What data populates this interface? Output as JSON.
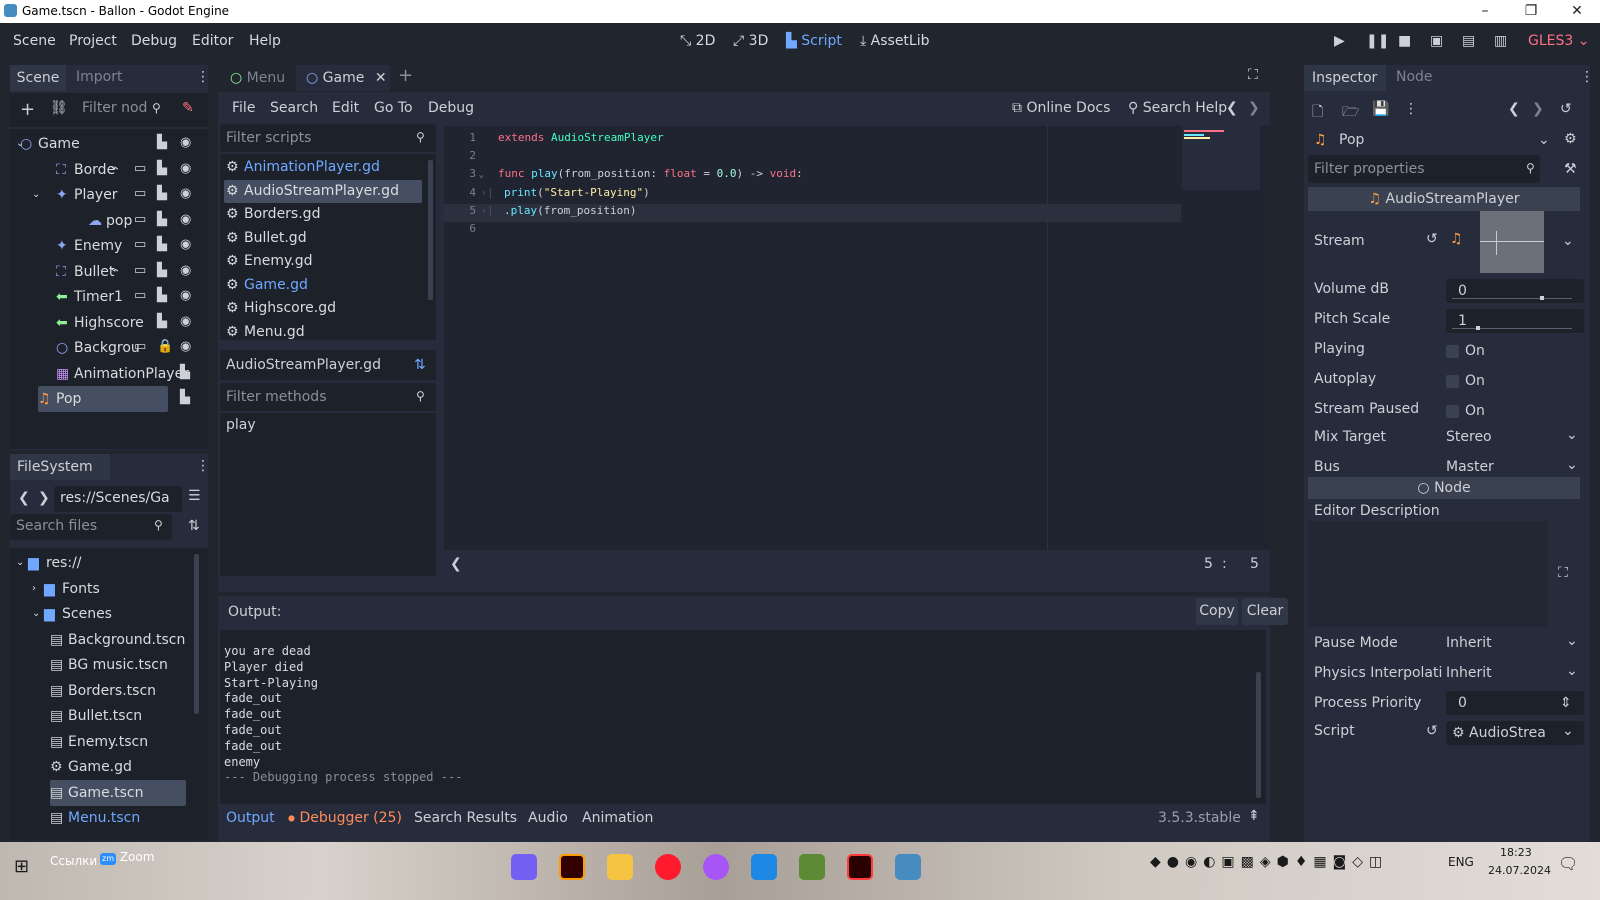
{
  "window": {
    "title": "Game.tscn - Ballon - Godot Engine",
    "minimize": "–",
    "restore": "❐",
    "close": "✕"
  },
  "menu": {
    "items": [
      "Scene",
      "Project",
      "Debug",
      "Editor",
      "Help"
    ]
  },
  "workspaces": {
    "2d": "2D",
    "3d": "3D",
    "script": "Script",
    "assetlib": "AssetLib",
    "renderer": "GLES3"
  },
  "scene_dock": {
    "tab_scene": "Scene",
    "tab_import": "Import",
    "filter_placeholder": "Filter nod",
    "nodes": [
      {
        "label": "Game",
        "icon": "node-icon",
        "depth": 0
      },
      {
        "label": "Borde",
        "icon": "area-icon",
        "depth": 1
      },
      {
        "label": "Player",
        "icon": "kinematic-icon",
        "depth": 1
      },
      {
        "label": "pop",
        "icon": "particles-icon",
        "depth": 2
      },
      {
        "label": "Enemy",
        "icon": "kinematic-icon",
        "depth": 1
      },
      {
        "label": "Bullet",
        "icon": "area-icon",
        "depth": 1
      },
      {
        "label": "Timer1",
        "icon": "label-icon",
        "depth": 1
      },
      {
        "label": "Highscore",
        "icon": "label-icon",
        "depth": 1
      },
      {
        "label": "Backgrou",
        "icon": "node-icon",
        "depth": 1
      },
      {
        "label": "AnimationPlayer",
        "icon": "animation-icon",
        "depth": 1
      },
      {
        "label": "Pop",
        "icon": "audio-icon",
        "depth": 1
      }
    ]
  },
  "filesystem": {
    "tab": "FileSystem",
    "path": "res://Scenes/Ga",
    "search_placeholder": "Search files",
    "items": [
      {
        "label": "res://",
        "depth": 0,
        "type": "folder"
      },
      {
        "label": "Fonts",
        "depth": 1,
        "type": "folder"
      },
      {
        "label": "Scenes",
        "depth": 1,
        "type": "folder"
      },
      {
        "label": "Background.tscn",
        "depth": 2,
        "type": "scene"
      },
      {
        "label": "BG music.tscn",
        "depth": 2,
        "type": "scene"
      },
      {
        "label": "Borders.tscn",
        "depth": 2,
        "type": "scene"
      },
      {
        "label": "Bullet.tscn",
        "depth": 2,
        "type": "scene"
      },
      {
        "label": "Enemy.tscn",
        "depth": 2,
        "type": "scene"
      },
      {
        "label": "Game.gd",
        "depth": 2,
        "type": "script"
      },
      {
        "label": "Game.tscn",
        "depth": 2,
        "type": "scene"
      },
      {
        "label": "Menu.tscn",
        "depth": 2,
        "type": "scene"
      }
    ]
  },
  "editor_tabs": {
    "tab1": "Menu",
    "tab2": "Game",
    "add": "+"
  },
  "script_menu": {
    "items": [
      "File",
      "Search",
      "Edit",
      "Go To",
      "Debug"
    ],
    "online_docs": "Online Docs",
    "search_help": "Search Help"
  },
  "scripts_panel": {
    "filter_placeholder": "Filter scripts",
    "scripts": [
      "AnimationPlayer.gd",
      "AudioStreamPlayer.gd",
      "Borders.gd",
      "Bullet.gd",
      "Enemy.gd",
      "Game.gd",
      "Highscore.gd",
      "Menu.gd"
    ],
    "current": "AudioStreamPlayer.gd",
    "methods_placeholder": "Filter methods",
    "methods": [
      "play"
    ]
  },
  "code": {
    "line_numbers": [
      "1",
      "2",
      "3",
      "4",
      "5",
      "6"
    ],
    "l1_kw": "extends",
    "l1_type": "AudioStreamPlayer",
    "l3_kw": "func",
    "l3_fn": "play",
    "l3_a": "(from_position: ",
    "l3_type": "float",
    "l3_b": " = ",
    "l3_num": "0.0",
    "l3_c": ") -> ",
    "l3_ret": "void",
    "l3_d": ":",
    "l4_fn": "print",
    "l4_a": "(",
    "l4_str": "\"Start-Playing\"",
    "l4_b": ")",
    "l5_a": ".",
    "l5_fn": "play",
    "l5_b": "(from_position)",
    "cursor_line": "5",
    "cursor_sep": ":",
    "cursor_col": "5"
  },
  "output": {
    "title": "Output:",
    "copy": "Copy",
    "clear": "Clear",
    "lines": [
      "you are dead",
      "Player died",
      "Start-Playing",
      "fade_out",
      "fade_out",
      "fade_out",
      "fade_out",
      "enemy"
    ],
    "stopped": "--- Debugging process stopped ---"
  },
  "bottom_tabs": {
    "output": "Output",
    "debugger": "Debugger (25)",
    "search_results": "Search Results",
    "audio": "Audio",
    "animation": "Animation",
    "version": "3.5.3.stable"
  },
  "inspector": {
    "tab_inspector": "Inspector",
    "tab_node": "Node",
    "node_name": "Pop",
    "filter_placeholder": "Filter properties",
    "class_header": "AudioStreamPlayer",
    "stream_label": "Stream",
    "volume_label": "Volume dB",
    "volume_value": "0",
    "pitch_label": "Pitch Scale",
    "pitch_value": "1",
    "playing_label": "Playing",
    "playing_value": "On",
    "autoplay_label": "Autoplay",
    "autoplay_value": "On",
    "stream_paused_label": "Stream Paused",
    "stream_paused_value": "On",
    "mix_target_label": "Mix Target",
    "mix_target_value": "Stereo",
    "bus_label": "Bus",
    "bus_value": "Master",
    "node_section": "Node",
    "editor_desc_label": "Editor Description",
    "pause_mode_label": "Pause Mode",
    "pause_mode_value": "Inherit",
    "physics_interp_label": "Physics Interpolati",
    "physics_interp_value": "Inherit",
    "process_priority_label": "Process Priority",
    "process_priority_value": "0",
    "script_label": "Script",
    "script_value": "AudioStrea"
  },
  "taskbar": {
    "links": "Ссылки",
    "zoom": "Zoom",
    "lang": "ENG",
    "time": "18:23",
    "date": "24.07.2024"
  },
  "colors": {
    "accent": "#70a8ff",
    "debugger": "#ff8a5c",
    "bg": "#20252e",
    "panel": "#262c3b"
  }
}
